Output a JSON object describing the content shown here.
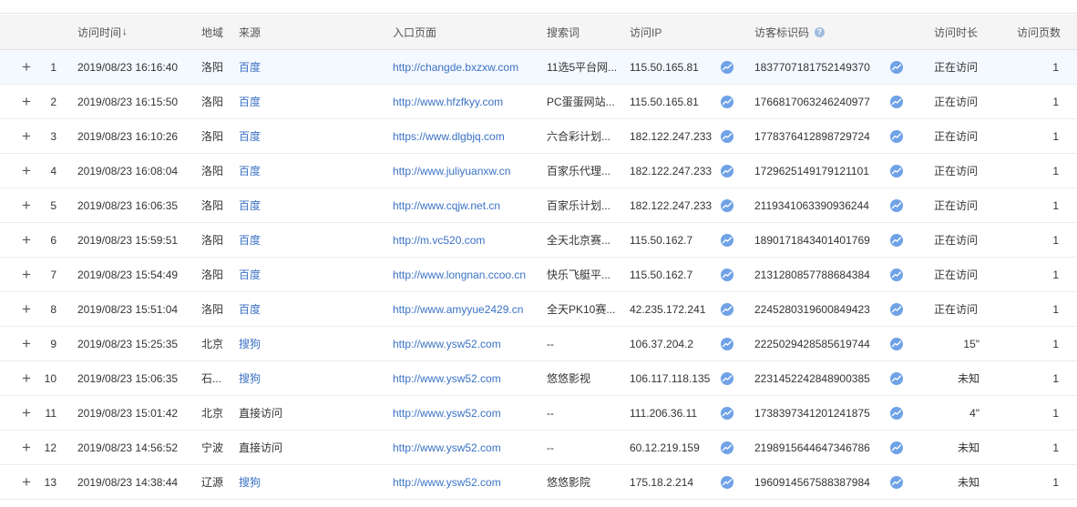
{
  "header": {
    "time": "访问时间",
    "time_sort": "↓",
    "region": "地域",
    "source": "来源",
    "entry_page": "入口页面",
    "keyword": "搜索词",
    "ip": "访问IP",
    "visitor_id": "访客标识码",
    "help": "?",
    "duration": "访问时长",
    "pages": "访问页数"
  },
  "expand_symbol": "+",
  "rows": [
    {
      "num": "1",
      "time": "2019/08/23 16:16:40",
      "region": "洛阳",
      "source": "百度",
      "source_link": true,
      "entry": "http://changde.bxzxw.com",
      "keyword": "11选5平台网...",
      "ip": "115.50.165.81",
      "visitor_id": "1837707181752149370",
      "duration": "正在访问",
      "duration_right": false,
      "pages": "1"
    },
    {
      "num": "2",
      "time": "2019/08/23 16:15:50",
      "region": "洛阳",
      "source": "百度",
      "source_link": true,
      "entry": "http://www.hfzfkyy.com",
      "keyword": "PC蛋蛋网站...",
      "ip": "115.50.165.81",
      "visitor_id": "1766817063246240977",
      "duration": "正在访问",
      "duration_right": false,
      "pages": "1"
    },
    {
      "num": "3",
      "time": "2019/08/23 16:10:26",
      "region": "洛阳",
      "source": "百度",
      "source_link": true,
      "entry": "https://www.dlgbjq.com",
      "keyword": "六合彩计划...",
      "ip": "182.122.247.233",
      "visitor_id": "1778376412898729724",
      "duration": "正在访问",
      "duration_right": false,
      "pages": "1"
    },
    {
      "num": "4",
      "time": "2019/08/23 16:08:04",
      "region": "洛阳",
      "source": "百度",
      "source_link": true,
      "entry": "http://www.juliyuanxw.cn",
      "keyword": "百家乐代理...",
      "ip": "182.122.247.233",
      "visitor_id": "1729625149179121101",
      "duration": "正在访问",
      "duration_right": false,
      "pages": "1"
    },
    {
      "num": "5",
      "time": "2019/08/23 16:06:35",
      "region": "洛阳",
      "source": "百度",
      "source_link": true,
      "entry": "http://www.cqjw.net.cn",
      "keyword": "百家乐计划...",
      "ip": "182.122.247.233",
      "visitor_id": "2119341063390936244",
      "duration": "正在访问",
      "duration_right": false,
      "pages": "1"
    },
    {
      "num": "6",
      "time": "2019/08/23 15:59:51",
      "region": "洛阳",
      "source": "百度",
      "source_link": true,
      "entry": "http://m.vc520.com",
      "keyword": "全天北京赛...",
      "ip": "115.50.162.7",
      "visitor_id": "1890171843401401769",
      "duration": "正在访问",
      "duration_right": false,
      "pages": "1"
    },
    {
      "num": "7",
      "time": "2019/08/23 15:54:49",
      "region": "洛阳",
      "source": "百度",
      "source_link": true,
      "entry": "http://www.longnan.ccoo.cn",
      "keyword": "快乐飞艇平...",
      "ip": "115.50.162.7",
      "visitor_id": "2131280857788684384",
      "duration": "正在访问",
      "duration_right": false,
      "pages": "1"
    },
    {
      "num": "8",
      "time": "2019/08/23 15:51:04",
      "region": "洛阳",
      "source": "百度",
      "source_link": true,
      "entry": "http://www.amyyue2429.cn",
      "keyword": "全天PK10赛...",
      "ip": "42.235.172.241",
      "visitor_id": "2245280319600849423",
      "duration": "正在访问",
      "duration_right": false,
      "pages": "1"
    },
    {
      "num": "9",
      "time": "2019/08/23 15:25:35",
      "region": "北京",
      "source": "搜狗",
      "source_link": true,
      "entry": "http://www.ysw52.com",
      "keyword": "--",
      "ip": "106.37.204.2",
      "visitor_id": "2225029428585619744",
      "duration": "15\"",
      "duration_right": true,
      "pages": "1"
    },
    {
      "num": "10",
      "time": "2019/08/23 15:06:35",
      "region": "石...",
      "source": "搜狗",
      "source_link": true,
      "entry": "http://www.ysw52.com",
      "keyword": "悠悠影视",
      "ip": "106.117.118.135",
      "visitor_id": "2231452242848900385",
      "duration": "未知",
      "duration_right": true,
      "pages": "1"
    },
    {
      "num": "11",
      "time": "2019/08/23 15:01:42",
      "region": "北京",
      "source": "直接访问",
      "source_link": false,
      "entry": "http://www.ysw52.com",
      "keyword": "--",
      "ip": "111.206.36.11",
      "visitor_id": "1738397341201241875",
      "duration": "4\"",
      "duration_right": true,
      "pages": "1"
    },
    {
      "num": "12",
      "time": "2019/08/23 14:56:52",
      "region": "宁波",
      "source": "直接访问",
      "source_link": false,
      "entry": "http://www.ysw52.com",
      "keyword": "--",
      "ip": "60.12.219.159",
      "visitor_id": "2198915644647346786",
      "duration": "未知",
      "duration_right": true,
      "pages": "1"
    },
    {
      "num": "13",
      "time": "2019/08/23 14:38:44",
      "region": "辽源",
      "source": "搜狗",
      "source_link": true,
      "entry": "http://www.ysw52.com",
      "keyword": "悠悠影院",
      "ip": "175.18.2.214",
      "visitor_id": "1960914567588387984",
      "duration": "未知",
      "duration_right": true,
      "pages": "1"
    }
  ],
  "icons": {
    "trend": "trend-chart-icon",
    "help": "help-question-icon",
    "expand": "plus-icon",
    "sort": "sort-down-arrow-icon"
  },
  "colors": {
    "link": "#3a72c4",
    "header_bg": "#f5f5f5",
    "highlight_row": "#f4f8ff",
    "trend_icon": "#6fa2e6"
  }
}
